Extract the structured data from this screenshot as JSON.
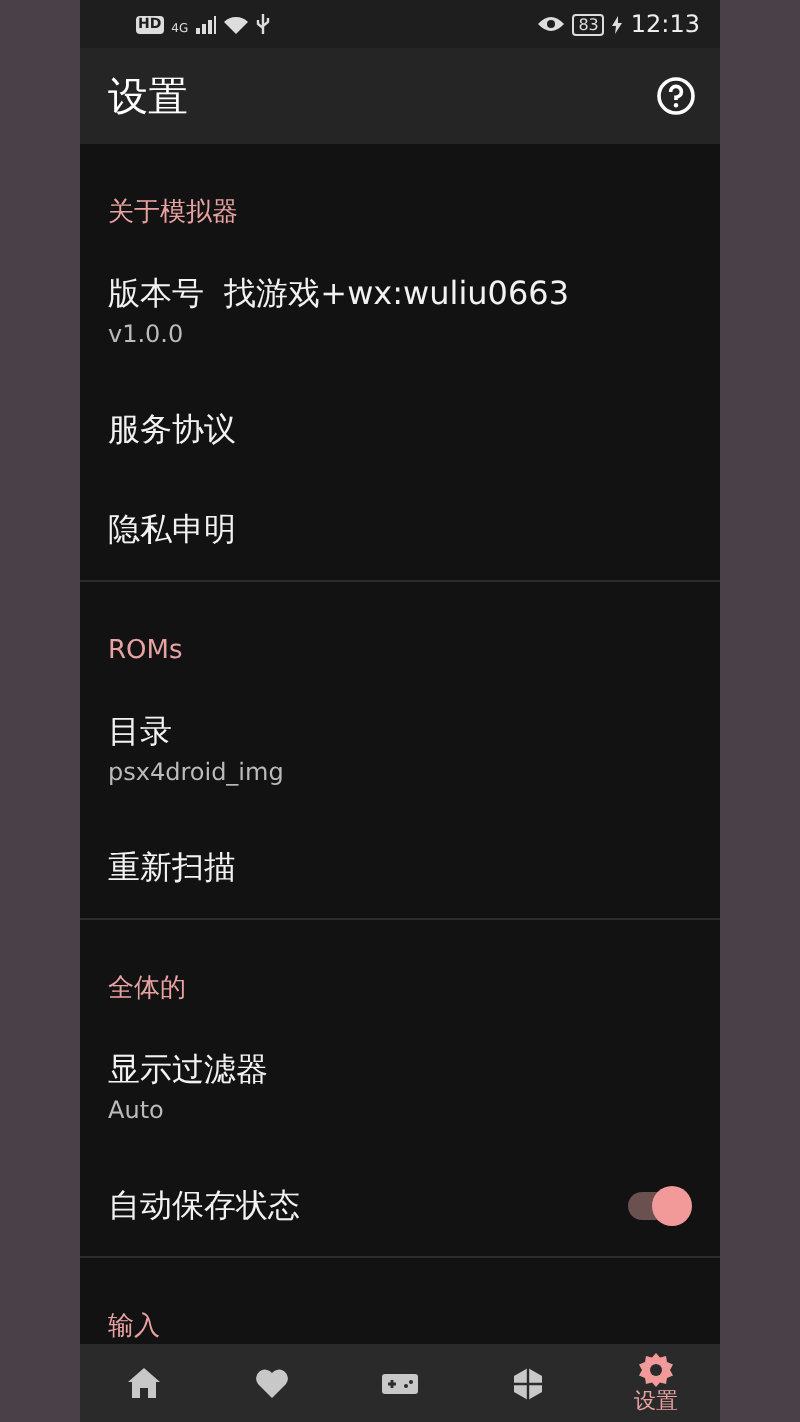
{
  "status_bar": {
    "network_badges": [
      "HD",
      "4G"
    ],
    "battery": "83",
    "time": "12:13"
  },
  "app_bar": {
    "title": "设置"
  },
  "sections": [
    {
      "title": "关于模拟器",
      "items": [
        {
          "kind": "info",
          "title": "版本号  找游戏+wx:wuliu0663",
          "subtitle": "v1.0.0"
        },
        {
          "kind": "link",
          "title": "服务协议"
        },
        {
          "kind": "link",
          "title": "隐私申明"
        }
      ]
    },
    {
      "title": "ROMs",
      "items": [
        {
          "kind": "info",
          "title": "目录",
          "subtitle": "psx4droid_img"
        },
        {
          "kind": "link",
          "title": "重新扫描"
        }
      ]
    },
    {
      "title": "全体的",
      "items": [
        {
          "kind": "info",
          "title": "显示过滤器",
          "subtitle": "Auto"
        },
        {
          "kind": "toggle",
          "title": "自动保存状态",
          "on": true
        }
      ]
    },
    {
      "title": "输入"
    }
  ],
  "bottom_nav": [
    {
      "kind": "home",
      "selected": false
    },
    {
      "kind": "favorites",
      "selected": false
    },
    {
      "kind": "games",
      "selected": false
    },
    {
      "kind": "plugins",
      "selected": false
    },
    {
      "kind": "settings",
      "label": "设置",
      "selected": true
    }
  ]
}
